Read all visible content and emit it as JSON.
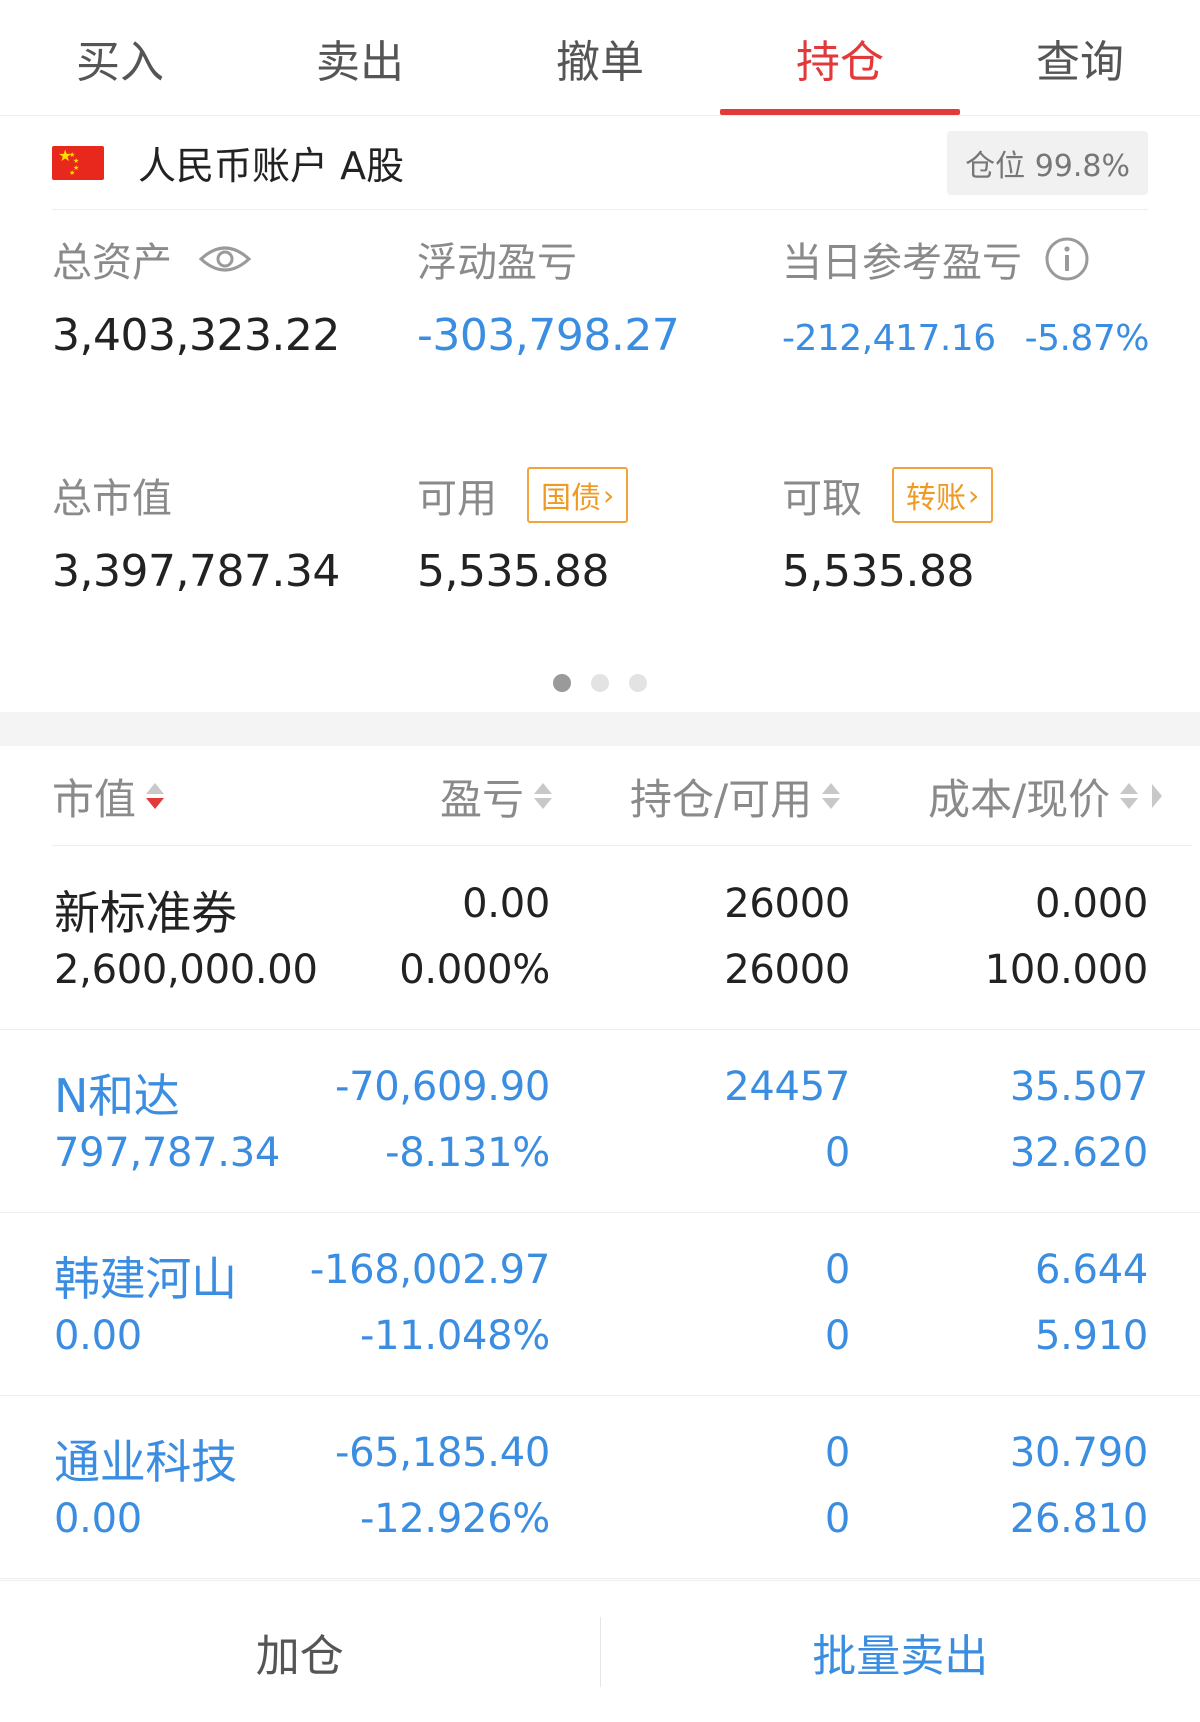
{
  "tabs": [
    {
      "label": "买入",
      "active": false
    },
    {
      "label": "卖出",
      "active": false
    },
    {
      "label": "撤单",
      "active": false
    },
    {
      "label": "持仓",
      "active": true
    },
    {
      "label": "查询",
      "active": false
    }
  ],
  "account": {
    "flag_icon": "china-flag-icon",
    "name": "人民币账户 A股",
    "position_badge": "仓位 99.8%"
  },
  "summary": {
    "total_assets_label": "总资产",
    "total_assets_value": "3,403,323.22",
    "floating_pnl_label": "浮动盈亏",
    "floating_pnl_value": "-303,798.27",
    "daily_pnl_label": "当日参考盈亏",
    "daily_pnl_value": "-212,417.16",
    "daily_pnl_pct": "-5.87%",
    "market_value_label": "总市值",
    "market_value_value": "3,397,787.34",
    "available_label": "可用",
    "available_tag": "国债",
    "available_value": "5,535.88",
    "withdrawable_label": "可取",
    "withdrawable_tag": "转账",
    "withdrawable_value": "5,535.88",
    "page_dots": 3,
    "page_dot_active": 0
  },
  "table": {
    "headers": [
      "市值",
      "盈亏",
      "持仓/可用",
      "成本/现价"
    ],
    "rows": [
      {
        "name": "新标准券",
        "market_value": "2,600,000.00",
        "pnl": "0.00",
        "pnl_pct": "0.000%",
        "position": "26000",
        "available": "26000",
        "cost": "0.000",
        "price": "100.000",
        "color": "black"
      },
      {
        "name": "N和达",
        "market_value": "797,787.34",
        "pnl": "-70,609.90",
        "pnl_pct": "-8.131%",
        "position": "24457",
        "available": "0",
        "cost": "35.507",
        "price": "32.620",
        "color": "blue"
      },
      {
        "name": "韩建河山",
        "market_value": "0.00",
        "pnl": "-168,002.97",
        "pnl_pct": "-11.048%",
        "position": "0",
        "available": "0",
        "cost": "6.644",
        "price": "5.910",
        "color": "blue"
      },
      {
        "name": "通业科技",
        "market_value": "0.00",
        "pnl": "-65,185.40",
        "pnl_pct": "-12.926%",
        "position": "0",
        "available": "0",
        "cost": "30.790",
        "price": "26.810",
        "color": "blue"
      }
    ]
  },
  "bottom": {
    "add_label": "加仓",
    "batch_sell_label": "批量卖出"
  },
  "colors": {
    "accent_red": "#e23a3a",
    "loss_blue": "#3a8de0",
    "tag_orange": "#ef9a25"
  }
}
